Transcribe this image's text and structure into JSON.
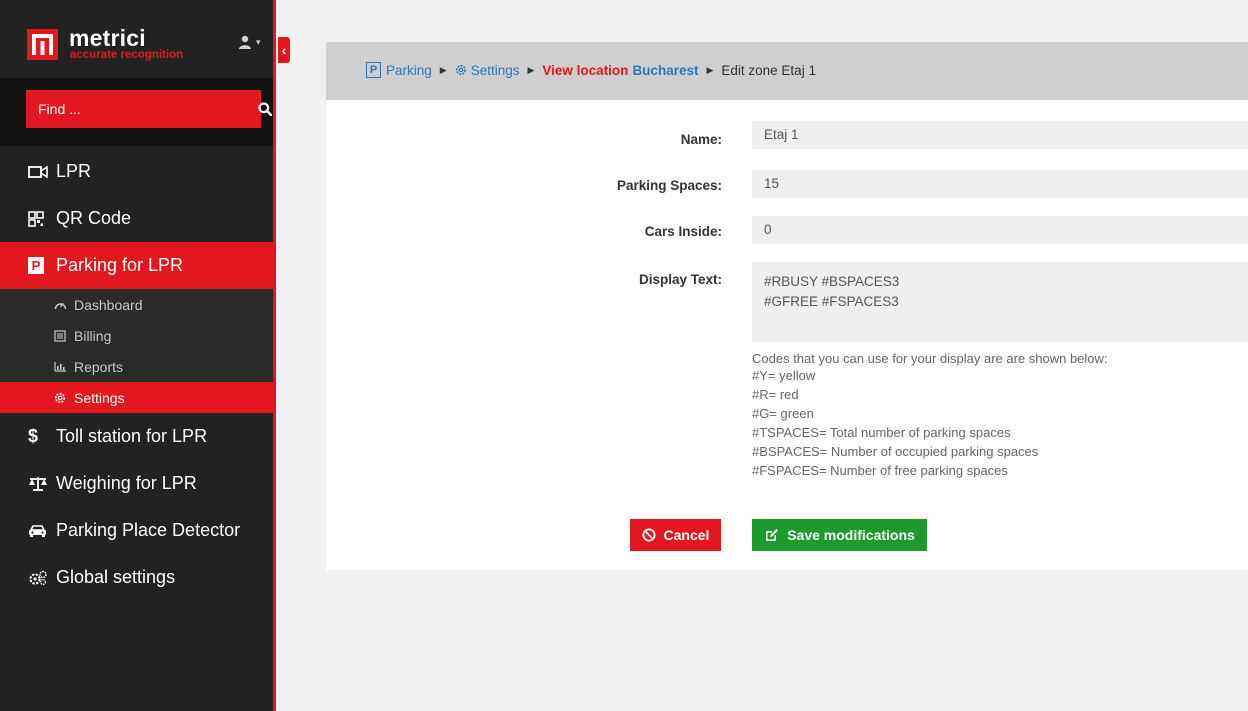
{
  "brand": {
    "name": "metrici",
    "tagline": "accurate recognition",
    "user_caret": "▾",
    "collapse_glyph": "‹"
  },
  "search": {
    "placeholder": "Find ..."
  },
  "nav": {
    "lpr": "LPR",
    "qr": "QR Code",
    "parking": "Parking for LPR",
    "parking_badge": "P",
    "sub": {
      "dashboard": "Dashboard",
      "billing": "Billing",
      "reports": "Reports",
      "settings": "Settings"
    },
    "toll": "Toll station for LPR",
    "weighing": "Weighing for LPR",
    "detector": "Parking Place Detector",
    "global": "Global settings"
  },
  "breadcrumb": {
    "badge": "P",
    "parking": "Parking",
    "settings": "Settings",
    "view_location": "View location",
    "location_name": "Bucharest",
    "current": "Edit zone Etaj 1",
    "separator": "▶"
  },
  "form": {
    "name_label": "Name:",
    "name_value": "Etaj 1",
    "spaces_label": "Parking Spaces:",
    "spaces_value": "15",
    "inside_label": "Cars Inside:",
    "inside_value": "0",
    "display_label": "Display Text:",
    "display_line1": "#RBUSY #BSPACES3",
    "display_line2": "#GFREE #FSPACES3",
    "help": [
      "Codes that you can use for your display are are shown below:",
      "#Y= yellow",
      "#R= red",
      "#G= green",
      "#TSPACES= Total number of parking spaces",
      "#BSPACES= Number of occupied parking spaces",
      "#FSPACES= Number of free parking spaces"
    ],
    "cancel": "Cancel",
    "save": "Save modifications"
  },
  "colors": {
    "accent": "#e3171f",
    "link": "#2979b9",
    "save": "#1c9a2e",
    "sidebar": "#222222"
  }
}
